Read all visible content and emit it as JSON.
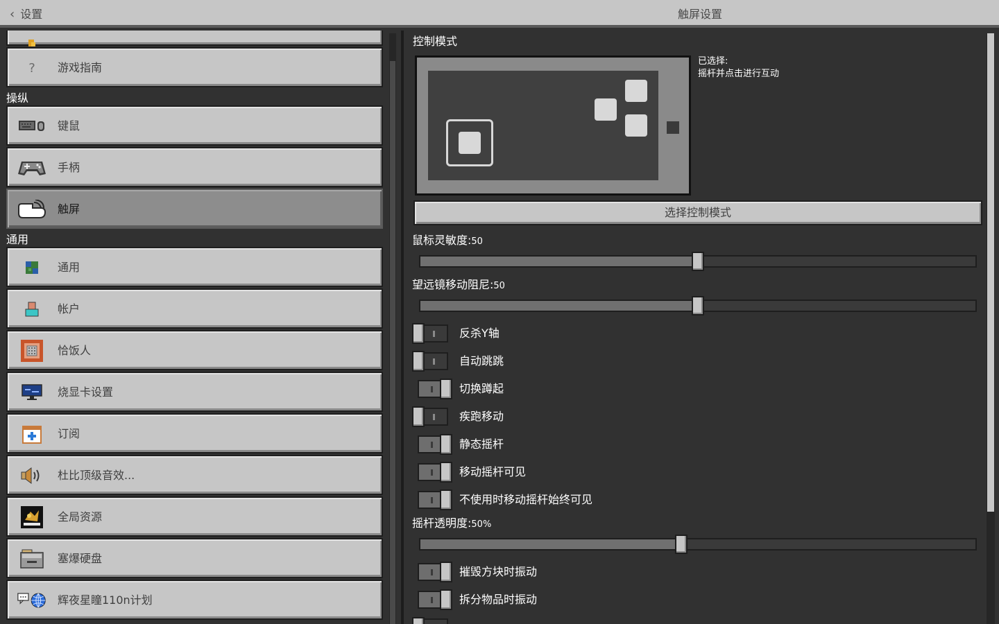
{
  "header": {
    "back_label": "设置",
    "title": "触屏设置"
  },
  "sidebar": {
    "sections": [
      {
        "label": "操纵"
      },
      {
        "label": "通用"
      }
    ],
    "items": [
      {
        "label": ""
      },
      {
        "label": "游戏指南",
        "icon": "question-icon"
      },
      {
        "label": "键鼠",
        "icon": "keyboard-mouse-icon"
      },
      {
        "label": "手柄",
        "icon": "gamepad-icon"
      },
      {
        "label": "触屏",
        "icon": "touch-hand-icon",
        "active": true
      },
      {
        "label": "通用",
        "icon": "globe-block-icon"
      },
      {
        "label": "帐户",
        "icon": "account-icon"
      },
      {
        "label": "恰饭人",
        "icon": "creator-icon"
      },
      {
        "label": "烧显卡设置",
        "icon": "monitor-icon"
      },
      {
        "label": "订阅",
        "icon": "calendar-plus-icon"
      },
      {
        "label": "杜比顶级音效...",
        "icon": "speaker-icon"
      },
      {
        "label": "全局资源",
        "icon": "resource-pack-icon"
      },
      {
        "label": "塞爆硬盘",
        "icon": "storage-drive-icon"
      },
      {
        "label": "辉夜星瞳110n计划",
        "icon": "language-globe-icon"
      }
    ]
  },
  "main": {
    "control_mode_label": "控制模式",
    "selected_prefix": "已选择:",
    "selected_value": "摇杆并点击进行互动",
    "select_mode_button": "选择控制模式",
    "sliders": [
      {
        "label": "鼠标灵敏度:",
        "value_text": "50",
        "value": 0.5
      },
      {
        "label": "望远镜移动阻尼:",
        "value_text": "50",
        "value": 0.5
      },
      {
        "label": "摇杆透明度:",
        "value_text": "50%",
        "value": 0.47
      }
    ],
    "toggles": [
      {
        "label": "反杀Y轴",
        "on": false
      },
      {
        "label": "自动跳跳",
        "on": false
      },
      {
        "label": "切换蹲起",
        "on": true
      },
      {
        "label": "疾跑移动",
        "on": false
      },
      {
        "label": "静态摇杆",
        "on": true
      },
      {
        "label": "移动摇杆可见",
        "on": true
      },
      {
        "label": "不使用时移动摇杆始终可见",
        "on": true
      },
      {
        "label": "摧毁方块时振动",
        "on": true
      },
      {
        "label": "拆分物品时振动",
        "on": true
      },
      {
        "label": "",
        "on": false
      }
    ]
  },
  "colors": {
    "panel_bg": "#313131",
    "button_bg": "#c6c6c6",
    "active_bg": "#8d8d8d",
    "text_light": "#ffffff",
    "text_dark": "#404040"
  }
}
